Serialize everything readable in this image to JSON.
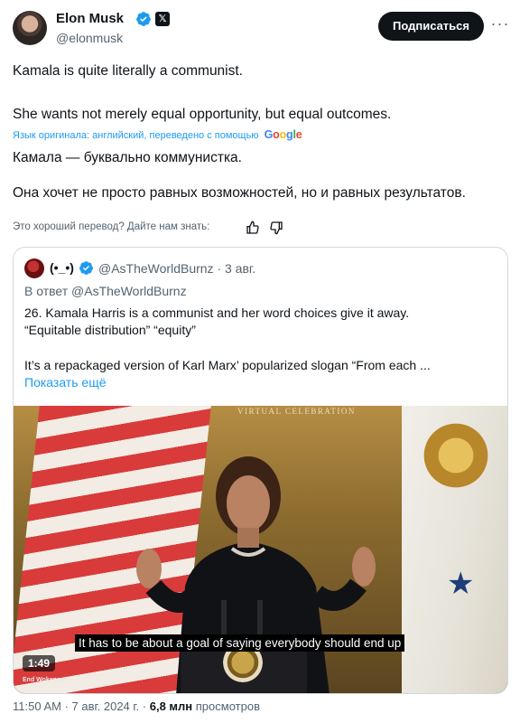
{
  "header": {
    "author_name": "Elon Musk",
    "handle": "@elonmusk",
    "subscribe_label": "Подписаться",
    "more_icon": "more-horizontal-icon",
    "verified_icon": "verified-badge-icon",
    "x_badge": "𝕏"
  },
  "tweet": {
    "original_line1": "Kamala is quite literally a communist.",
    "original_line2": "She wants not merely equal opportunity, but equal outcomes.",
    "translated_note": "Язык оригинала: английский, переведено с помощью",
    "translated_provider": [
      "G",
      "o",
      "o",
      "g",
      "l",
      "e"
    ],
    "translation_line1": "Камала — буквально коммунистка.",
    "translation_line2": "Она хочет не просто равных возможностей, но и равных результатов."
  },
  "feedback": {
    "prompt": "Это хороший перевод? Дайте нам знать:",
    "thumbs_up_icon": "thumbs-up-icon",
    "thumbs_down_icon": "thumbs-down-icon"
  },
  "quote": {
    "author_name": "(•_•)",
    "handle_and_date": "@AsTheWorldBurnz · 3 авг.",
    "reply_to": "В ответ @AsTheWorldBurnz",
    "line1": "26. Kamala Harris is a communist and her word choices give it away.",
    "line2": "“Equitable distribution” “equity”",
    "line3": "It’s a repackaged version of Karl Marx’ popularized slogan “From each ...",
    "show_more": "Показать ещё"
  },
  "video": {
    "banner": "VIRTUAL CELEBRATION",
    "caption": "It has to be about a goal of saying everybody should end up",
    "duration": "1:49",
    "watermark": "End Wokeness"
  },
  "footer": {
    "time_date": "11:50 AM · 7 авг. 2024 г. · ",
    "views_count": "6,8 млн",
    "views_label": " просмотров"
  },
  "colors": {
    "accent": "#1d9bf0",
    "text": "#0f1419",
    "secondary": "#536471",
    "border": "#cfd9de"
  }
}
